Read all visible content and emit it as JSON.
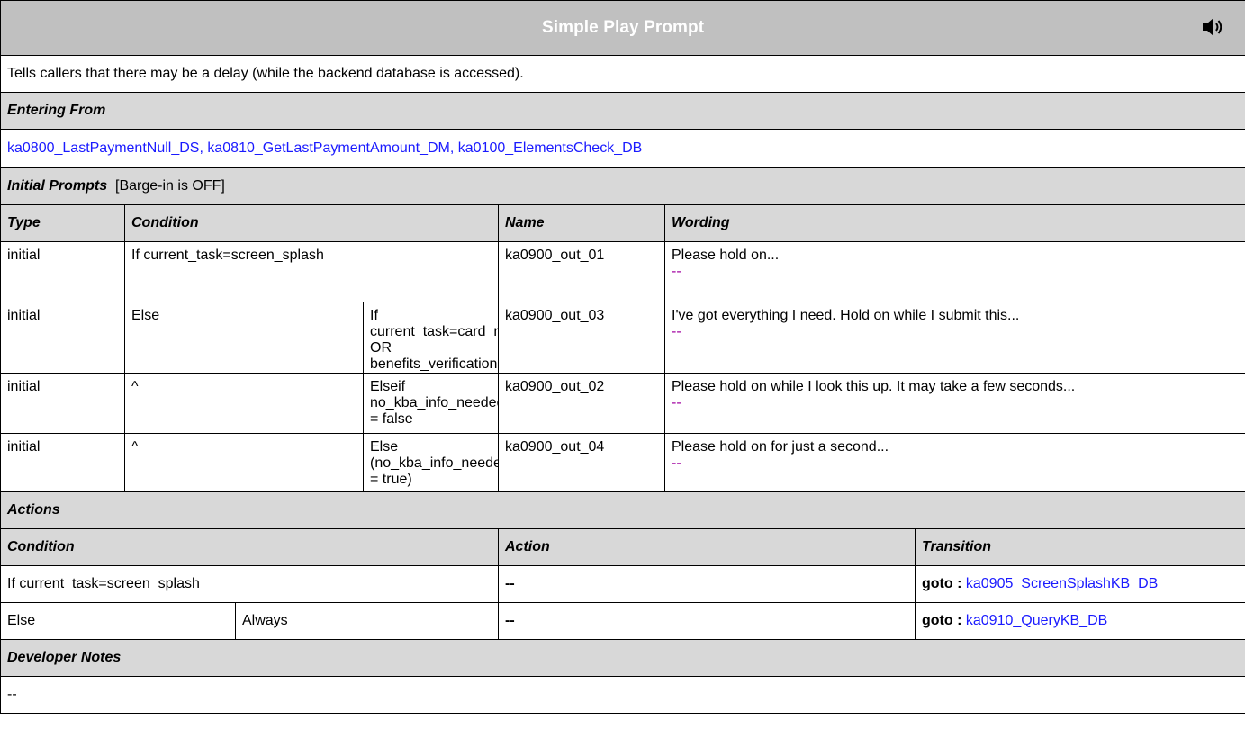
{
  "title": "Simple Play Prompt",
  "description": "Tells callers that there may be a delay (while the backend database is accessed).",
  "entering_from": {
    "label": "Entering From",
    "links": [
      "ka0800_LastPaymentNull_DS",
      "ka0810_GetLastPaymentAmount_DM",
      "ka0100_ElementsCheck_DB"
    ],
    "separator": ","
  },
  "initial_prompts": {
    "label": "Initial Prompts",
    "barge": "[Barge-in is OFF]",
    "headers": {
      "type": "Type",
      "condition": "Condition",
      "name": "Name",
      "wording": "Wording"
    },
    "rows": [
      {
        "type": "initial",
        "cond1": "If current_task=screen_splash",
        "cond2": "",
        "name": "ka0900_out_01",
        "wording": "Please hold on...",
        "dash": "--"
      },
      {
        "type": "initial",
        "cond1": "Else",
        "cond2": "If current_task=card_medicare OR benefits_verification",
        "name": "ka0900_out_03",
        "wording": "I've got everything I need. Hold on while I submit this...",
        "dash": "--"
      },
      {
        "type": "initial",
        "cond1": "^",
        "cond2": "Elseif no_kba_info_needed = false",
        "name": "ka0900_out_02",
        "wording": "Please hold on while I look this up. It may take a few seconds...",
        "dash": "--"
      },
      {
        "type": "initial",
        "cond1": "^",
        "cond2": "Else (no_kba_info_needed = true)",
        "name": "ka0900_out_04",
        "wording": "Please hold on for just a second...",
        "dash": "--"
      }
    ]
  },
  "actions": {
    "label": "Actions",
    "headers": {
      "condition": "Condition",
      "action": "Action",
      "transition": "Transition"
    },
    "rows": [
      {
        "cond1": "If current_task=screen_splash",
        "cond2": "",
        "action": "--",
        "goto": "goto :",
        "target": "ka0905_ScreenSplashKB_DB"
      },
      {
        "cond1": "Else",
        "cond2": "Always",
        "action": "--",
        "goto": "goto :",
        "target": "ka0910_QueryKB_DB"
      }
    ]
  },
  "developer_notes": {
    "label": "Developer Notes",
    "text": "--"
  },
  "icons": {
    "speaker": "speaker-icon"
  }
}
